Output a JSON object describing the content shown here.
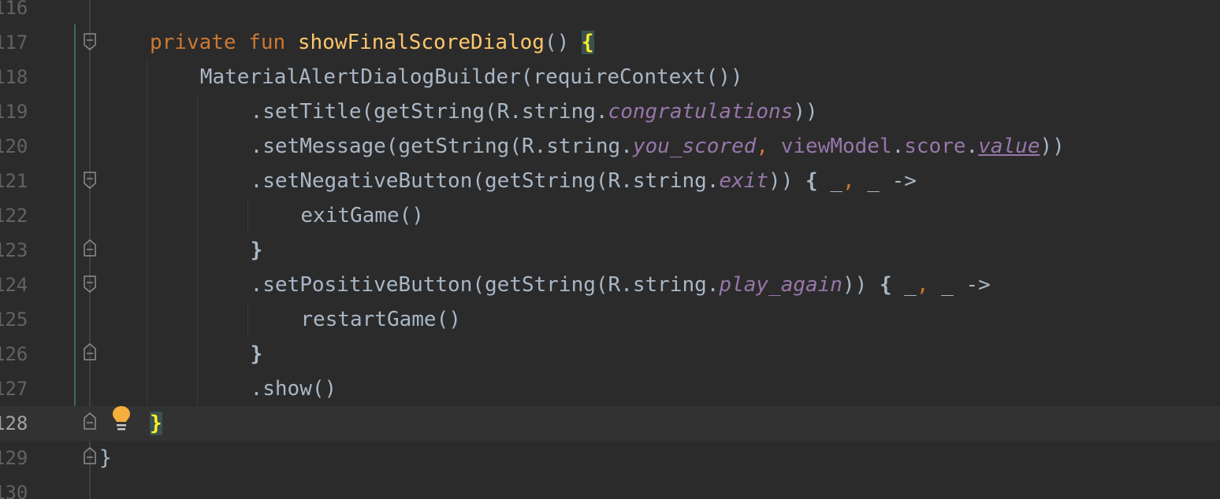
{
  "editor": {
    "lines": [
      {
        "num": "116",
        "tokens": []
      },
      {
        "num": "117",
        "tokens": [
          {
            "t": "private ",
            "c": "kw"
          },
          {
            "t": "fun ",
            "c": "kw"
          },
          {
            "t": "showFinalScoreDialog",
            "c": "fn"
          },
          {
            "t": "() ",
            "c": "plain"
          },
          {
            "t": "{",
            "c": "brace-hl"
          }
        ]
      },
      {
        "num": "118",
        "tokens": [
          {
            "t": "MaterialAlertDialogBuilder(requireContext())",
            "c": "plain"
          }
        ]
      },
      {
        "num": "119",
        "tokens": [
          {
            "t": ".setTitle(getString(R.string.",
            "c": "plain"
          },
          {
            "t": "congratulations",
            "c": "prop"
          },
          {
            "t": "))",
            "c": "plain"
          }
        ]
      },
      {
        "num": "120",
        "tokens": [
          {
            "t": ".setMessage(getString(R.string.",
            "c": "plain"
          },
          {
            "t": "you_scored",
            "c": "prop"
          },
          {
            "t": ", ",
            "c": "comma"
          },
          {
            "t": "viewModel",
            "c": "prop-plain"
          },
          {
            "t": ".",
            "c": "plain"
          },
          {
            "t": "score",
            "c": "prop-plain"
          },
          {
            "t": ".",
            "c": "plain"
          },
          {
            "t": "value",
            "c": "prop-u"
          },
          {
            "t": "))",
            "c": "plain"
          }
        ]
      },
      {
        "num": "121",
        "tokens": [
          {
            "t": ".setNegativeButton(getString(R.string.",
            "c": "plain"
          },
          {
            "t": "exit",
            "c": "prop"
          },
          {
            "t": ")) ",
            "c": "plain"
          },
          {
            "t": "{",
            "c": "brace"
          },
          {
            "t": " _",
            "c": "plain"
          },
          {
            "t": ",",
            "c": "comma"
          },
          {
            "t": " _ ->",
            "c": "plain"
          }
        ]
      },
      {
        "num": "122",
        "tokens": [
          {
            "t": "exitGame()",
            "c": "plain"
          }
        ]
      },
      {
        "num": "123",
        "tokens": [
          {
            "t": "}",
            "c": "brace"
          }
        ]
      },
      {
        "num": "124",
        "tokens": [
          {
            "t": ".setPositiveButton(getString(R.string.",
            "c": "plain"
          },
          {
            "t": "play_again",
            "c": "prop"
          },
          {
            "t": ")) ",
            "c": "plain"
          },
          {
            "t": "{",
            "c": "brace"
          },
          {
            "t": " _",
            "c": "plain"
          },
          {
            "t": ",",
            "c": "comma"
          },
          {
            "t": " _ ->",
            "c": "plain"
          }
        ]
      },
      {
        "num": "125",
        "tokens": [
          {
            "t": "restartGame()",
            "c": "plain"
          }
        ]
      },
      {
        "num": "126",
        "tokens": [
          {
            "t": "}",
            "c": "brace"
          }
        ]
      },
      {
        "num": "127",
        "tokens": [
          {
            "t": ".show()",
            "c": "plain"
          }
        ]
      },
      {
        "num": "128",
        "tokens": [
          {
            "t": "}",
            "c": "brace-hl"
          }
        ]
      },
      {
        "num": "129",
        "tokens": [
          {
            "t": "}",
            "c": "plain"
          }
        ]
      },
      {
        "num": "130",
        "tokens": []
      }
    ]
  }
}
